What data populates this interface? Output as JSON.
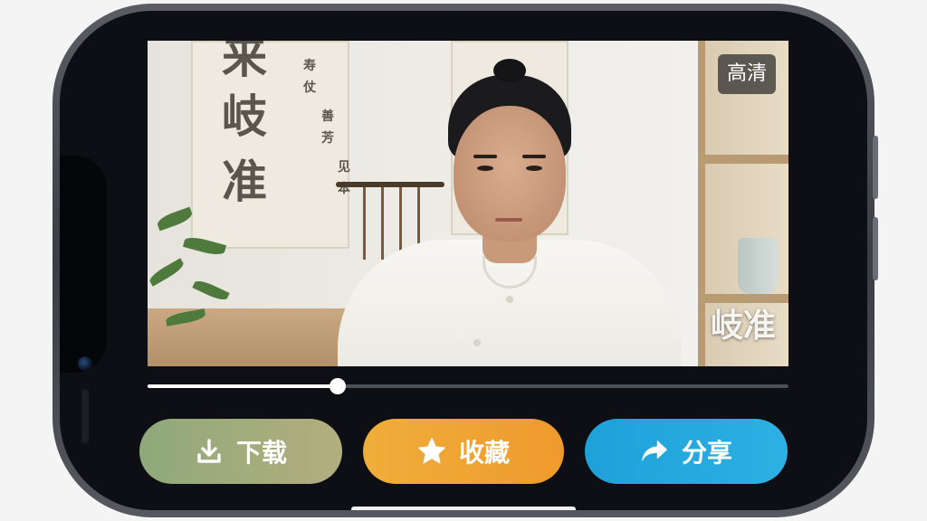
{
  "video": {
    "quality_badge": "高清",
    "watermark": "岐准",
    "calligraphy": {
      "big": [
        "岐",
        "准"
      ],
      "top_partial": "来",
      "col1": "寿仗",
      "col2": "善芳",
      "col3": "见本"
    },
    "progress": 0.297
  },
  "actions": {
    "download_label": "下载",
    "favorite_label": "收藏",
    "share_label": "分享"
  },
  "colors": {
    "download": "#a3ad7c",
    "favorite": "#efa434",
    "share": "#24a8de",
    "screen_bg": "#0d0f14"
  },
  "icons": {
    "download": "download-icon",
    "favorite": "star-icon",
    "share": "share-arrow-icon"
  }
}
